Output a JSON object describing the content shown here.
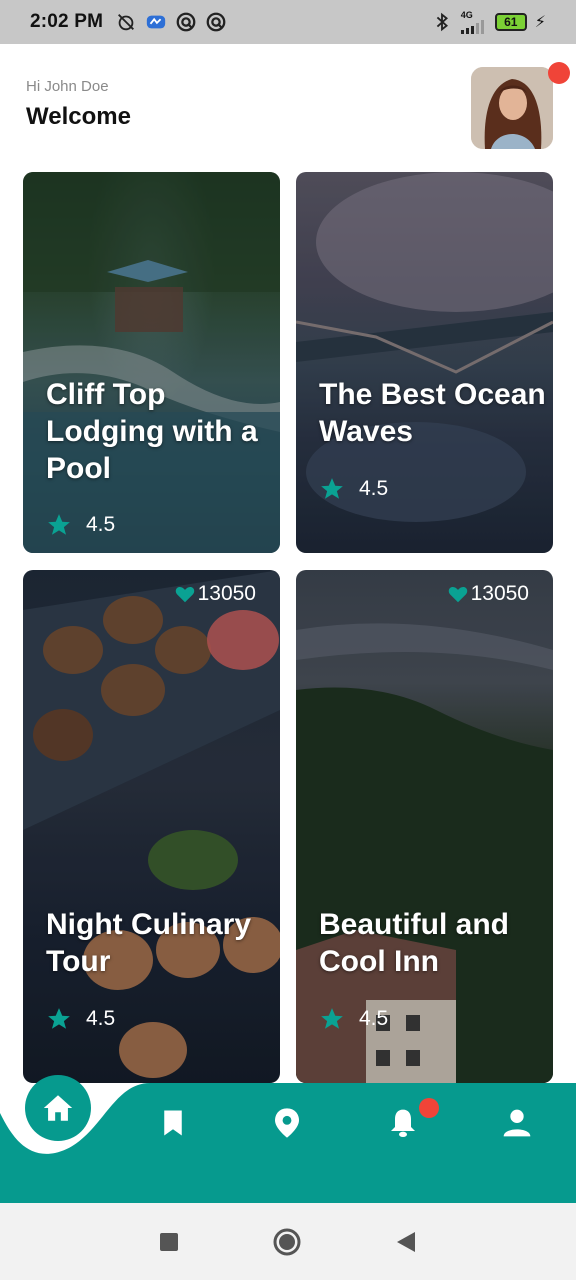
{
  "status_bar": {
    "time": "2:02 PM",
    "network_label": "4G",
    "battery": "61",
    "icons": [
      "alarm-off-icon",
      "cloud-app-icon",
      "vpn-icon",
      "vpn-icon",
      "bluetooth-icon",
      "signal-icon",
      "battery-icon",
      "charging-icon"
    ]
  },
  "header": {
    "greeting": "Hi John Doe",
    "title": "Welcome"
  },
  "cards": [
    {
      "title": "Cliff Top Lodging with a Pool",
      "rating": "4.5"
    },
    {
      "title": "The Best Ocean Waves",
      "rating": "4.5"
    },
    {
      "title": "Night Culinary Tour",
      "rating": "4.5",
      "likes": "13050"
    },
    {
      "title": "Beautiful and Cool Inn",
      "rating": "4.5",
      "likes": "13050"
    }
  ],
  "bottom_nav": {
    "items": [
      "home-icon",
      "bookmark-icon",
      "location-pin-icon",
      "bell-icon",
      "user-icon"
    ],
    "active": "home-icon",
    "accent": "#069a8e",
    "badge_color": "#f04438"
  },
  "system_nav": [
    "recents-square-icon",
    "home-circle-icon",
    "back-triangle-icon"
  ]
}
